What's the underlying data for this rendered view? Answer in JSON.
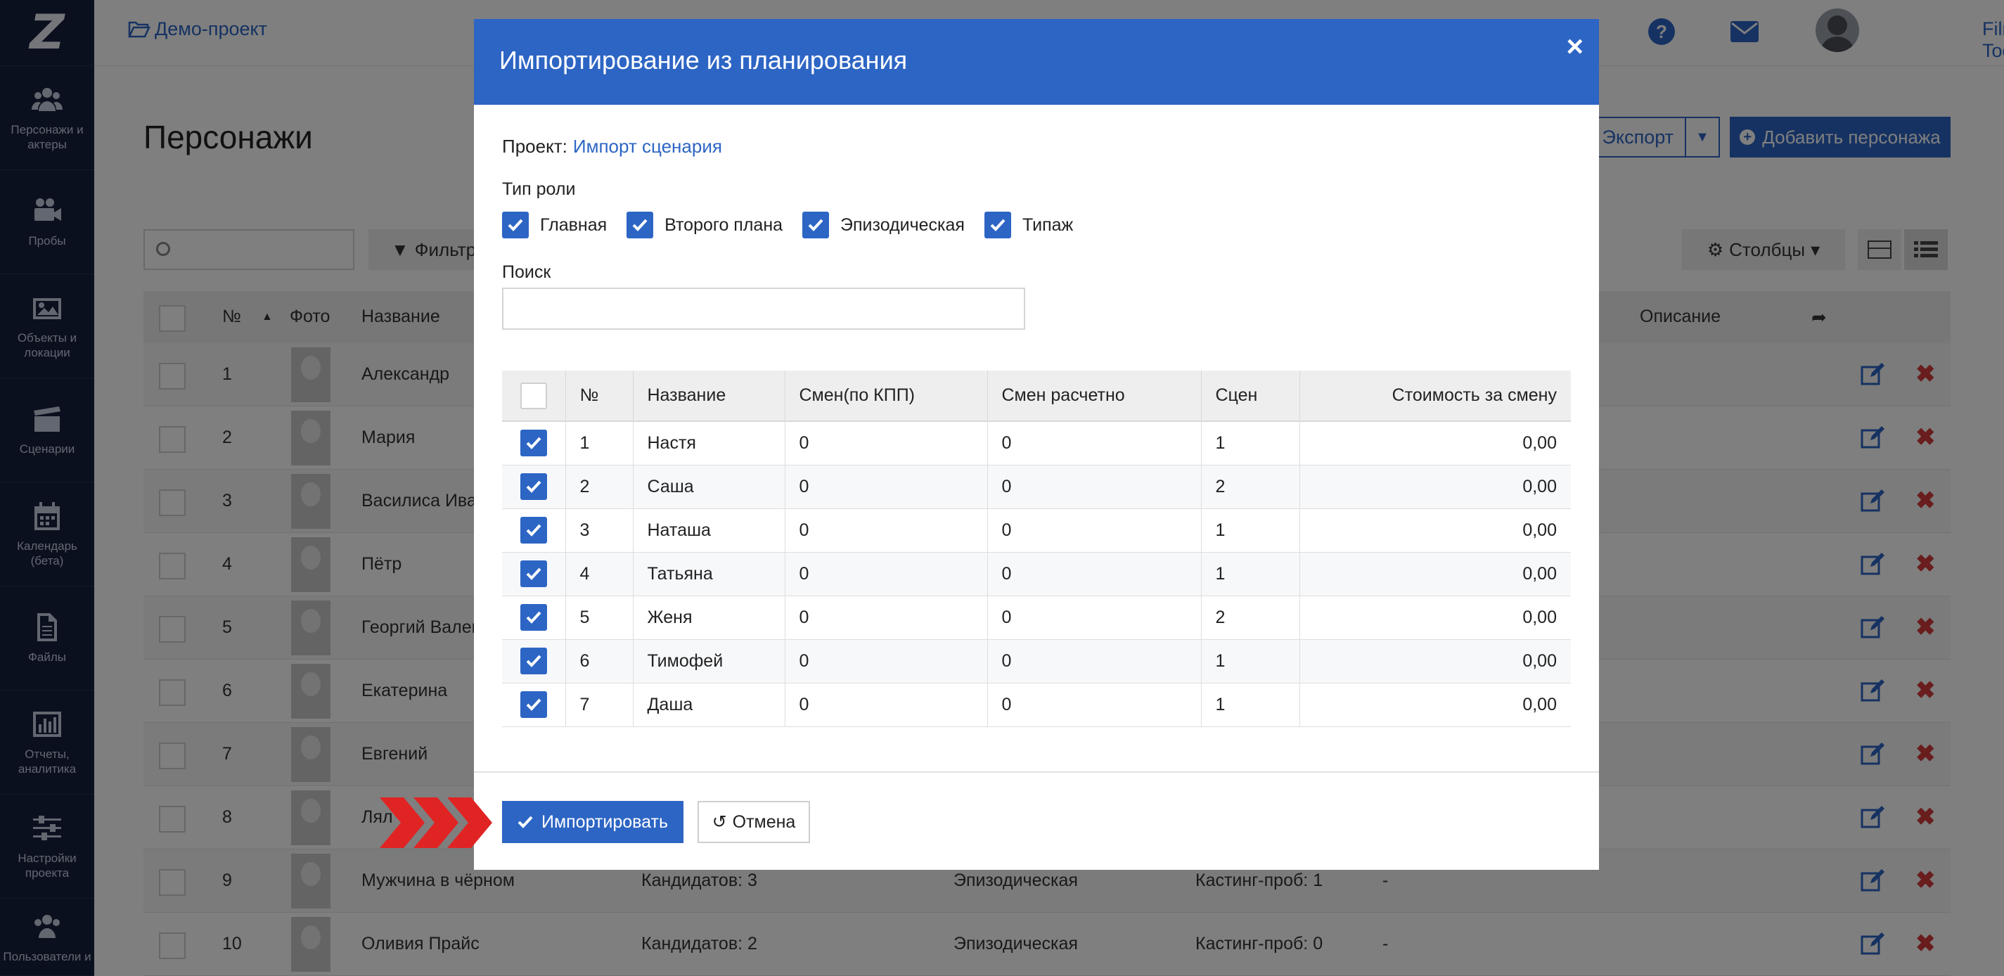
{
  "sidebar": {
    "logo": "Z",
    "items": [
      {
        "label": "Персонажи и актеры",
        "icon": "people-icon"
      },
      {
        "label": "Пробы",
        "icon": "video-camera-icon"
      },
      {
        "label": "Объекты и локации",
        "icon": "image-icon"
      },
      {
        "label": "Сценарии",
        "icon": "clapperboard-icon"
      },
      {
        "label": "Календарь (бета)",
        "icon": "calendar-icon"
      },
      {
        "label": "Файлы",
        "icon": "file-icon"
      },
      {
        "label": "Отчеты, аналитика",
        "icon": "bar-chart-icon"
      },
      {
        "label": "Настройки проекта",
        "icon": "sliders-icon"
      },
      {
        "label": "Пользователи и",
        "icon": "users-icon"
      }
    ]
  },
  "topbar": {
    "project": "Демо-проект",
    "user_name": "Film Toolz",
    "help_icon": "?"
  },
  "page": {
    "title": "Персонажи",
    "export_label": "Экспорт",
    "add_label": "Добавить персонажа",
    "filter_label": "Фильтр",
    "columns_label": "Столбцы",
    "table_headers": {
      "num": "№",
      "photo": "Фото",
      "name": "Название",
      "description": "Описание"
    },
    "rows": [
      {
        "num": "1",
        "name": "Александр",
        "c3": "",
        "c4": "",
        "c5": "",
        "c6": ""
      },
      {
        "num": "2",
        "name": "Мария",
        "c3": "",
        "c4": "",
        "c5": "",
        "c6": ""
      },
      {
        "num": "3",
        "name": "Василиса Ива",
        "c3": "",
        "c4": "",
        "c5": "",
        "c6": ""
      },
      {
        "num": "4",
        "name": "Пётр",
        "c3": "",
        "c4": "",
        "c5": "",
        "c6": ""
      },
      {
        "num": "5",
        "name": "Георгий Вален",
        "c3": "",
        "c4": "",
        "c5": "",
        "c6": ""
      },
      {
        "num": "6",
        "name": "Екатерина",
        "c3": "",
        "c4": "",
        "c5": "",
        "c6": ""
      },
      {
        "num": "7",
        "name": "Евгений",
        "c3": "",
        "c4": "",
        "c5": "",
        "c6": ""
      },
      {
        "num": "8",
        "name": "Лял",
        "c3": "",
        "c4": "",
        "c5": "",
        "c6": ""
      },
      {
        "num": "9",
        "name": "Мужчина в чёрном",
        "c3": "Кандидатов: 3",
        "c4": "Эпизодическая",
        "c5": "Кастинг-проб: 1",
        "c6": "-"
      },
      {
        "num": "10",
        "name": "Оливия Прайс",
        "c3": "Кандидатов: 2",
        "c4": "Эпизодическая",
        "c5": "Кастинг-проб: 0",
        "c6": "-"
      }
    ]
  },
  "modal": {
    "title": "Импортирование из планирования",
    "close": "×",
    "project_label": "Проект:",
    "project_value": "Импорт сценария",
    "role_label": "Тип роли",
    "roles": [
      {
        "label": "Главная",
        "checked": true
      },
      {
        "label": "Второго плана",
        "checked": true
      },
      {
        "label": "Эпизодическая",
        "checked": true
      },
      {
        "label": "Типаж",
        "checked": true
      }
    ],
    "search_label": "Поиск",
    "search_value": "",
    "headers": [
      "№",
      "Название",
      "Смен(по КПП)",
      "Смен расчетно",
      "Сцен",
      "Стоимость за смену"
    ],
    "rows": [
      {
        "num": "1",
        "name": "Настя",
        "shifts_kpp": "0",
        "shifts_calc": "0",
        "scenes": "1",
        "cost": "0,00"
      },
      {
        "num": "2",
        "name": "Саша",
        "shifts_kpp": "0",
        "shifts_calc": "0",
        "scenes": "2",
        "cost": "0,00"
      },
      {
        "num": "3",
        "name": "Наташа",
        "shifts_kpp": "0",
        "shifts_calc": "0",
        "scenes": "1",
        "cost": "0,00"
      },
      {
        "num": "4",
        "name": "Татьяна",
        "shifts_kpp": "0",
        "shifts_calc": "0",
        "scenes": "1",
        "cost": "0,00"
      },
      {
        "num": "5",
        "name": "Женя",
        "shifts_kpp": "0",
        "shifts_calc": "0",
        "scenes": "2",
        "cost": "0,00"
      },
      {
        "num": "6",
        "name": "Тимофей",
        "shifts_kpp": "0",
        "shifts_calc": "0",
        "scenes": "1",
        "cost": "0,00"
      },
      {
        "num": "7",
        "name": "Даша",
        "shifts_kpp": "0",
        "shifts_calc": "0",
        "scenes": "1",
        "cost": "0,00"
      }
    ],
    "import_label": "Импортировать",
    "cancel_label": "Отмена"
  },
  "colors": {
    "accent": "#2d65c4",
    "sidebar_bg": "#16213f",
    "danger": "#d23a3a",
    "arrow": "#e02424"
  }
}
